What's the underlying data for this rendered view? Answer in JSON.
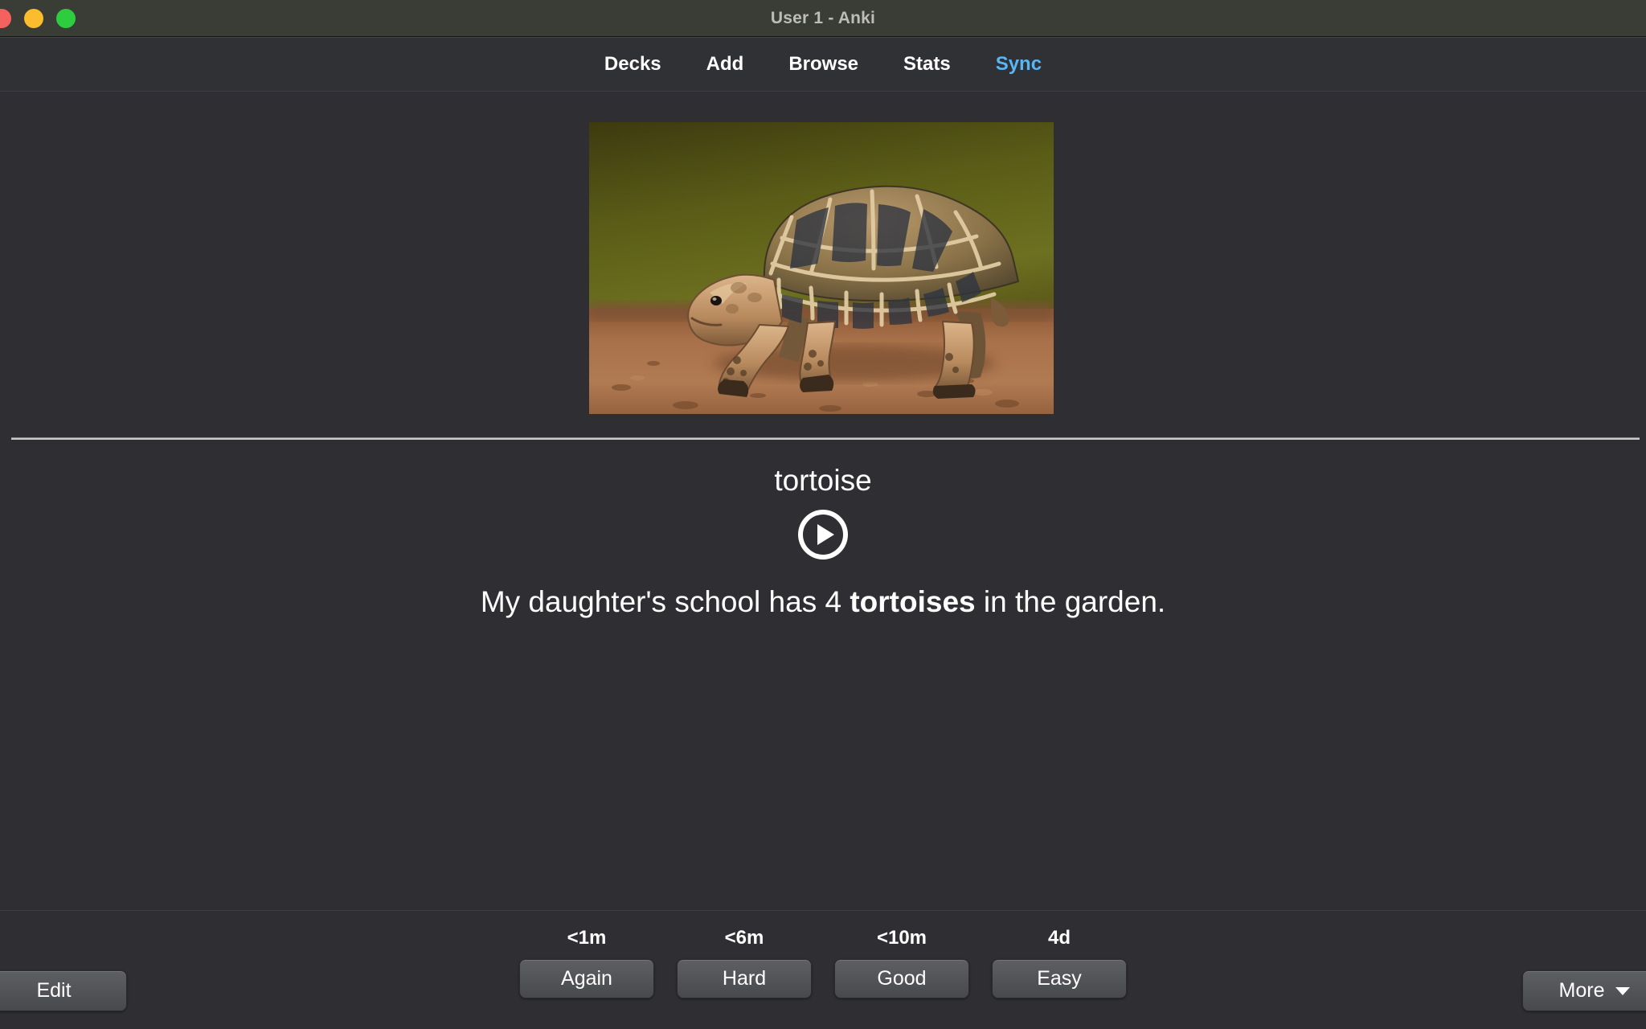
{
  "window": {
    "title": "User 1 - Anki",
    "traffic_lights": [
      {
        "name": "close",
        "color": "#f5615f"
      },
      {
        "name": "minimize",
        "color": "#fbbc2e"
      },
      {
        "name": "zoom",
        "color": "#2dcd3f"
      }
    ]
  },
  "nav": {
    "items": [
      {
        "label": "Decks",
        "active": false
      },
      {
        "label": "Add",
        "active": false
      },
      {
        "label": "Browse",
        "active": false
      },
      {
        "label": "Stats",
        "active": false
      },
      {
        "label": "Sync",
        "active": true
      }
    ],
    "accent_color": "#58b6f5"
  },
  "card": {
    "image_alt": "Indian star tortoise walking on reddish-brown dirt with blurred olive-green background",
    "word": "tortoise",
    "audio_icon": "play-icon",
    "sentence_prefix": "My daughter's school has 4 ",
    "sentence_bold": "tortoises",
    "sentence_suffix": " in the garden."
  },
  "bottom": {
    "edit_label": "Edit",
    "more_label": "More",
    "more_caret_icon": "chevron-down-icon",
    "ease_buttons": [
      {
        "time": "<1m",
        "label": "Again"
      },
      {
        "time": "<6m",
        "label": "Hard"
      },
      {
        "time": "<10m",
        "label": "Good"
      },
      {
        "time": "4d",
        "label": "Easy"
      }
    ]
  },
  "colors": {
    "background": "#2f2f33",
    "titlebar": "#3a3d36",
    "text": "#ffffff",
    "accent": "#58b6f5",
    "button": "#55565a"
  }
}
